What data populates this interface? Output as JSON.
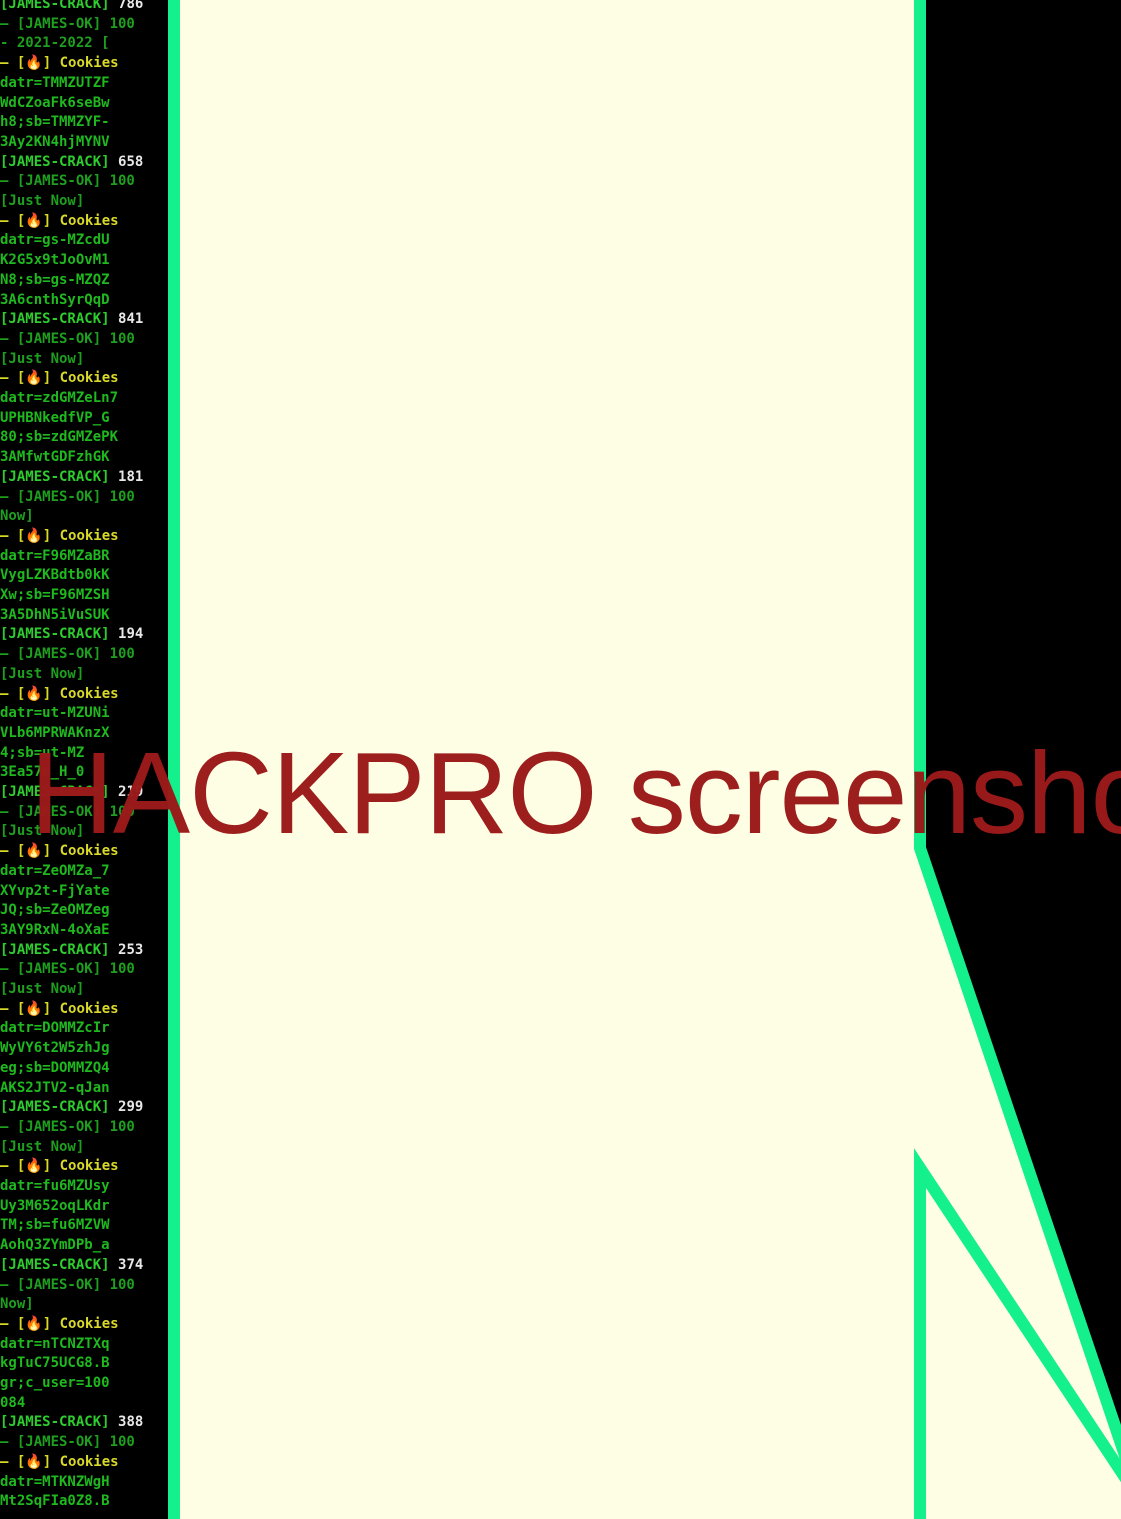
{
  "terminal": {
    "lines": [
      {
        "kind": "crack",
        "text": "[JAMES-CRACK] ",
        "num": "786"
      },
      {
        "kind": "ok",
        "text": "— [JAMES-OK] 100"
      },
      {
        "kind": "time",
        "text": "  - 2021-2022 [ "
      },
      {
        "kind": "cookies",
        "text": "— [",
        "fire": "🔥",
        "rest": "] Cookies"
      },
      {
        "kind": "data",
        "text": "  datr=TMMZUTZF"
      },
      {
        "kind": "data",
        "text": "  WdCZoaFk6seBw"
      },
      {
        "kind": "data",
        "text": "  h8;sb=TMMZYF-"
      },
      {
        "kind": "data",
        "text": "  3Ay2KN4hjMYNV"
      },
      {
        "kind": "crack",
        "text": "[JAMES-CRACK] ",
        "num": "658"
      },
      {
        "kind": "ok",
        "text": "— [JAMES-OK] 100"
      },
      {
        "kind": "time",
        "text": "  [Just Now]"
      },
      {
        "kind": "cookies",
        "text": "— [",
        "fire": "🔥",
        "rest": "] Cookies"
      },
      {
        "kind": "data",
        "text": "  datr=gs-MZcdU"
      },
      {
        "kind": "data",
        "text": "  K2G5x9tJoOvM1"
      },
      {
        "kind": "data",
        "text": "  N8;sb=gs-MZQZ"
      },
      {
        "kind": "data",
        "text": "  3A6cnthSyrQqD"
      },
      {
        "kind": "crack",
        "text": "[JAMES-CRACK] ",
        "num": "841"
      },
      {
        "kind": "ok",
        "text": "— [JAMES-OK] 100"
      },
      {
        "kind": "time",
        "text": "  [Just Now]"
      },
      {
        "kind": "cookies",
        "text": "— [",
        "fire": "🔥",
        "rest": "] Cookies"
      },
      {
        "kind": "data",
        "text": "  datr=zdGMZeLn7"
      },
      {
        "kind": "data",
        "text": "  UPHBNkedfVP_G"
      },
      {
        "kind": "data",
        "text": "  80;sb=zdGMZePK"
      },
      {
        "kind": "data",
        "text": "  3AMfwtGDFzhGK"
      },
      {
        "kind": "crack",
        "text": "[JAMES-CRACK] ",
        "num": "181"
      },
      {
        "kind": "ok",
        "text": "— [JAMES-OK] 100"
      },
      {
        "kind": "time",
        "text": "  Now]"
      },
      {
        "kind": "cookies",
        "text": "— [",
        "fire": "🔥",
        "rest": "] Cookies"
      },
      {
        "kind": "data",
        "text": "  datr=F96MZaBR"
      },
      {
        "kind": "data",
        "text": "  VygLZKBdtb0kK"
      },
      {
        "kind": "data",
        "text": "  Xw;sb=F96MZSH"
      },
      {
        "kind": "data",
        "text": "  3A5DhN5iVuSUK"
      },
      {
        "kind": "crack",
        "text": "[JAMES-CRACK] ",
        "num": "194"
      },
      {
        "kind": "ok",
        "text": "— [JAMES-OK] 100"
      },
      {
        "kind": "time",
        "text": "  [Just Now]"
      },
      {
        "kind": "cookies",
        "text": "— [",
        "fire": "🔥",
        "rest": "] Cookies"
      },
      {
        "kind": "data",
        "text": "  datr=ut-MZUNi"
      },
      {
        "kind": "data",
        "text": "  VLb6MPRWAKnzX"
      },
      {
        "kind": "data",
        "text": "  4;sb=ut-MZ"
      },
      {
        "kind": "data",
        "text": "  3Ea57e_H_0"
      },
      {
        "kind": "crack",
        "text": "[JAMES-CRACK] ",
        "num": "219"
      },
      {
        "kind": "ok",
        "text": "— [JAMES-OK] 100"
      },
      {
        "kind": "time",
        "text": "  [Just Now]"
      },
      {
        "kind": "cookies",
        "text": "— [",
        "fire": "🔥",
        "rest": "] Cookies"
      },
      {
        "kind": "data",
        "text": "  datr=ZeOMZa_7"
      },
      {
        "kind": "data",
        "text": "  XYvp2t-FjYate"
      },
      {
        "kind": "data",
        "text": "  JQ;sb=ZeOMZeg"
      },
      {
        "kind": "data",
        "text": "  3AY9RxN-4oXaE"
      },
      {
        "kind": "crack",
        "text": "[JAMES-CRACK] ",
        "num": "253"
      },
      {
        "kind": "ok",
        "text": "— [JAMES-OK] 100"
      },
      {
        "kind": "time",
        "text": "  [Just Now]"
      },
      {
        "kind": "cookies",
        "text": "— [",
        "fire": "🔥",
        "rest": "] Cookies"
      },
      {
        "kind": "data",
        "text": "  datr=DOMMZcIr"
      },
      {
        "kind": "data",
        "text": "  WyVY6t2W5zhJg"
      },
      {
        "kind": "data",
        "text": "  eg;sb=DOMMZQ4"
      },
      {
        "kind": "data",
        "text": "  AKS2JTV2-qJan"
      },
      {
        "kind": "crack",
        "text": "[JAMES-CRACK] ",
        "num": "299"
      },
      {
        "kind": "ok",
        "text": "— [JAMES-OK] 100"
      },
      {
        "kind": "time",
        "text": "  [Just Now]"
      },
      {
        "kind": "cookies",
        "text": "— [",
        "fire": "🔥",
        "rest": "] Cookies"
      },
      {
        "kind": "data",
        "text": "  datr=fu6MZUsy"
      },
      {
        "kind": "data",
        "text": "  Uy3M652oqLKdr"
      },
      {
        "kind": "data",
        "text": "  TM;sb=fu6MZVW"
      },
      {
        "kind": "data",
        "text": "  AohQ3ZYmDPb_a"
      },
      {
        "kind": "crack",
        "text": "[JAMES-CRACK] ",
        "num": "374"
      },
      {
        "kind": "ok",
        "text": "— [JAMES-OK] 100"
      },
      {
        "kind": "time",
        "text": "  Now]"
      },
      {
        "kind": "cookies",
        "text": "— [",
        "fire": "🔥",
        "rest": "] Cookies"
      },
      {
        "kind": "data",
        "text": "  datr=nTCNZTXq"
      },
      {
        "kind": "data",
        "text": "  kgTuC75UCG8.B"
      },
      {
        "kind": "data",
        "text": "  gr;c_user=100"
      },
      {
        "kind": "data",
        "text": "  084"
      },
      {
        "kind": "crack",
        "text": "[JAMES-CRACK] ",
        "num": "388"
      },
      {
        "kind": "ok",
        "text": "— [JAMES-OK] 100"
      },
      {
        "kind": "cookies",
        "text": "— [",
        "fire": "🔥",
        "rest": "] Cookies"
      },
      {
        "kind": "data",
        "text": "  datr=MTKNZWgH"
      },
      {
        "kind": "data",
        "text": "  Mt2SqFIa0Z8.B"
      }
    ]
  },
  "watermark": {
    "text": "HACKPRO screensho"
  },
  "colors": {
    "panel": "#fefee4",
    "outline": "#14f08c",
    "terminal_bg": "#000000",
    "watermark": "#9b1a1a"
  }
}
